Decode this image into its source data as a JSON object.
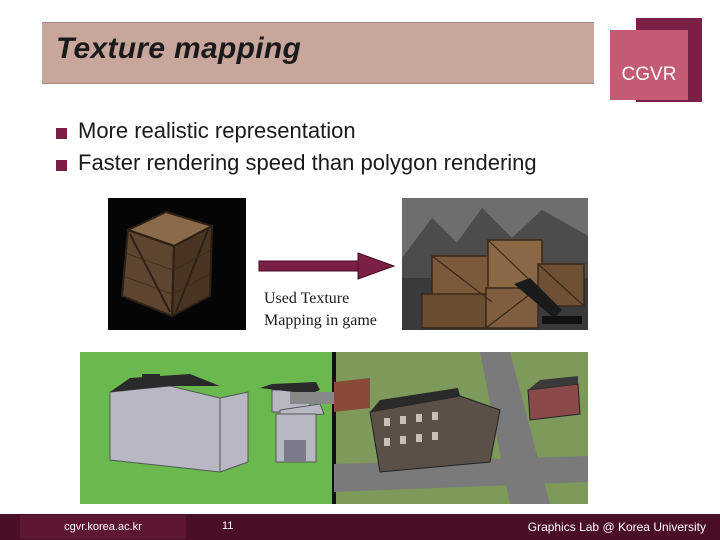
{
  "title": "Texture mapping",
  "logo": {
    "text": "CGVR"
  },
  "bullets": [
    "More realistic representation",
    "Faster rendering speed than polygon rendering"
  ],
  "caption": {
    "line1": "Used Texture",
    "line2": "Mapping in game"
  },
  "footer": {
    "left": "cgvr.korea.ac.kr",
    "page_number": "11",
    "right": "Graphics Lab @ Korea University"
  },
  "colors": {
    "title_bar": "#c9a69c",
    "accent": "#7a1f45",
    "logo": "#c35b74",
    "footer": "#4a0e29"
  }
}
